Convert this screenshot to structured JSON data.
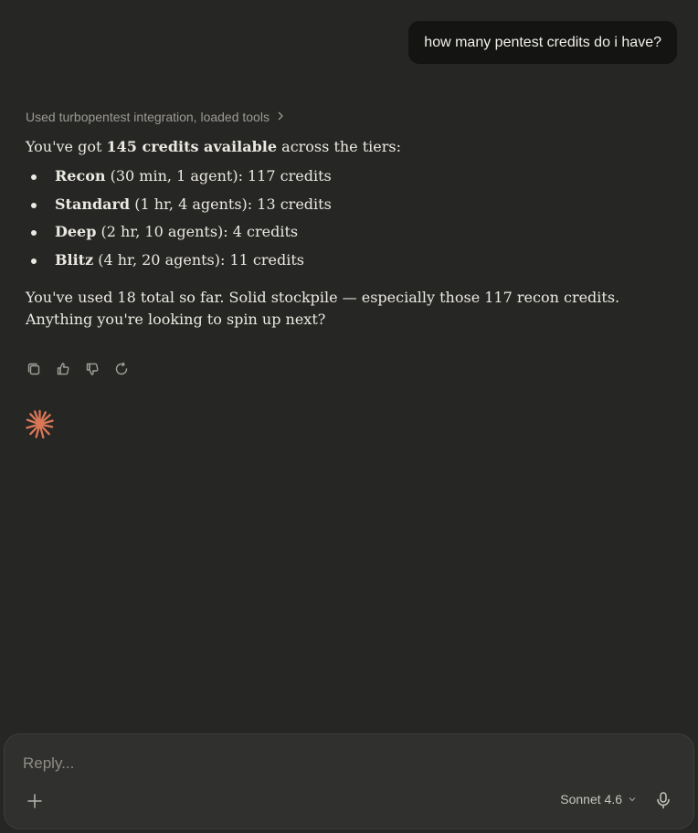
{
  "user_message": "how many pentest credits do i have?",
  "tool_summary": "Used turbopentest integration, loaded tools",
  "answer": {
    "intro_pre": "You've got ",
    "intro_bold": "145 credits available",
    "intro_post": " across the tiers:",
    "tiers": [
      {
        "name": "Recon",
        "detail": " (30 min, 1 agent): 117 credits"
      },
      {
        "name": "Standard",
        "detail": " (1 hr, 4 agents): 13 credits"
      },
      {
        "name": "Deep",
        "detail": " (2 hr, 10 agents): 4 credits"
      },
      {
        "name": "Blitz",
        "detail": " (4 hr, 20 agents): 11 credits"
      }
    ],
    "closing": "You've used 18 total so far. Solid stockpile — especially those 117 recon credits. Anything you're looking to spin up next?"
  },
  "actions": {
    "icons": [
      "copy-icon",
      "thumbs-up-icon",
      "thumbs-down-icon",
      "retry-icon"
    ]
  },
  "composer": {
    "placeholder": "Reply...",
    "model": "Sonnet 4.6"
  },
  "colors": {
    "background": "#262624",
    "bubble": "#141413",
    "accent": "#d97757",
    "composer": "#30302e"
  }
}
